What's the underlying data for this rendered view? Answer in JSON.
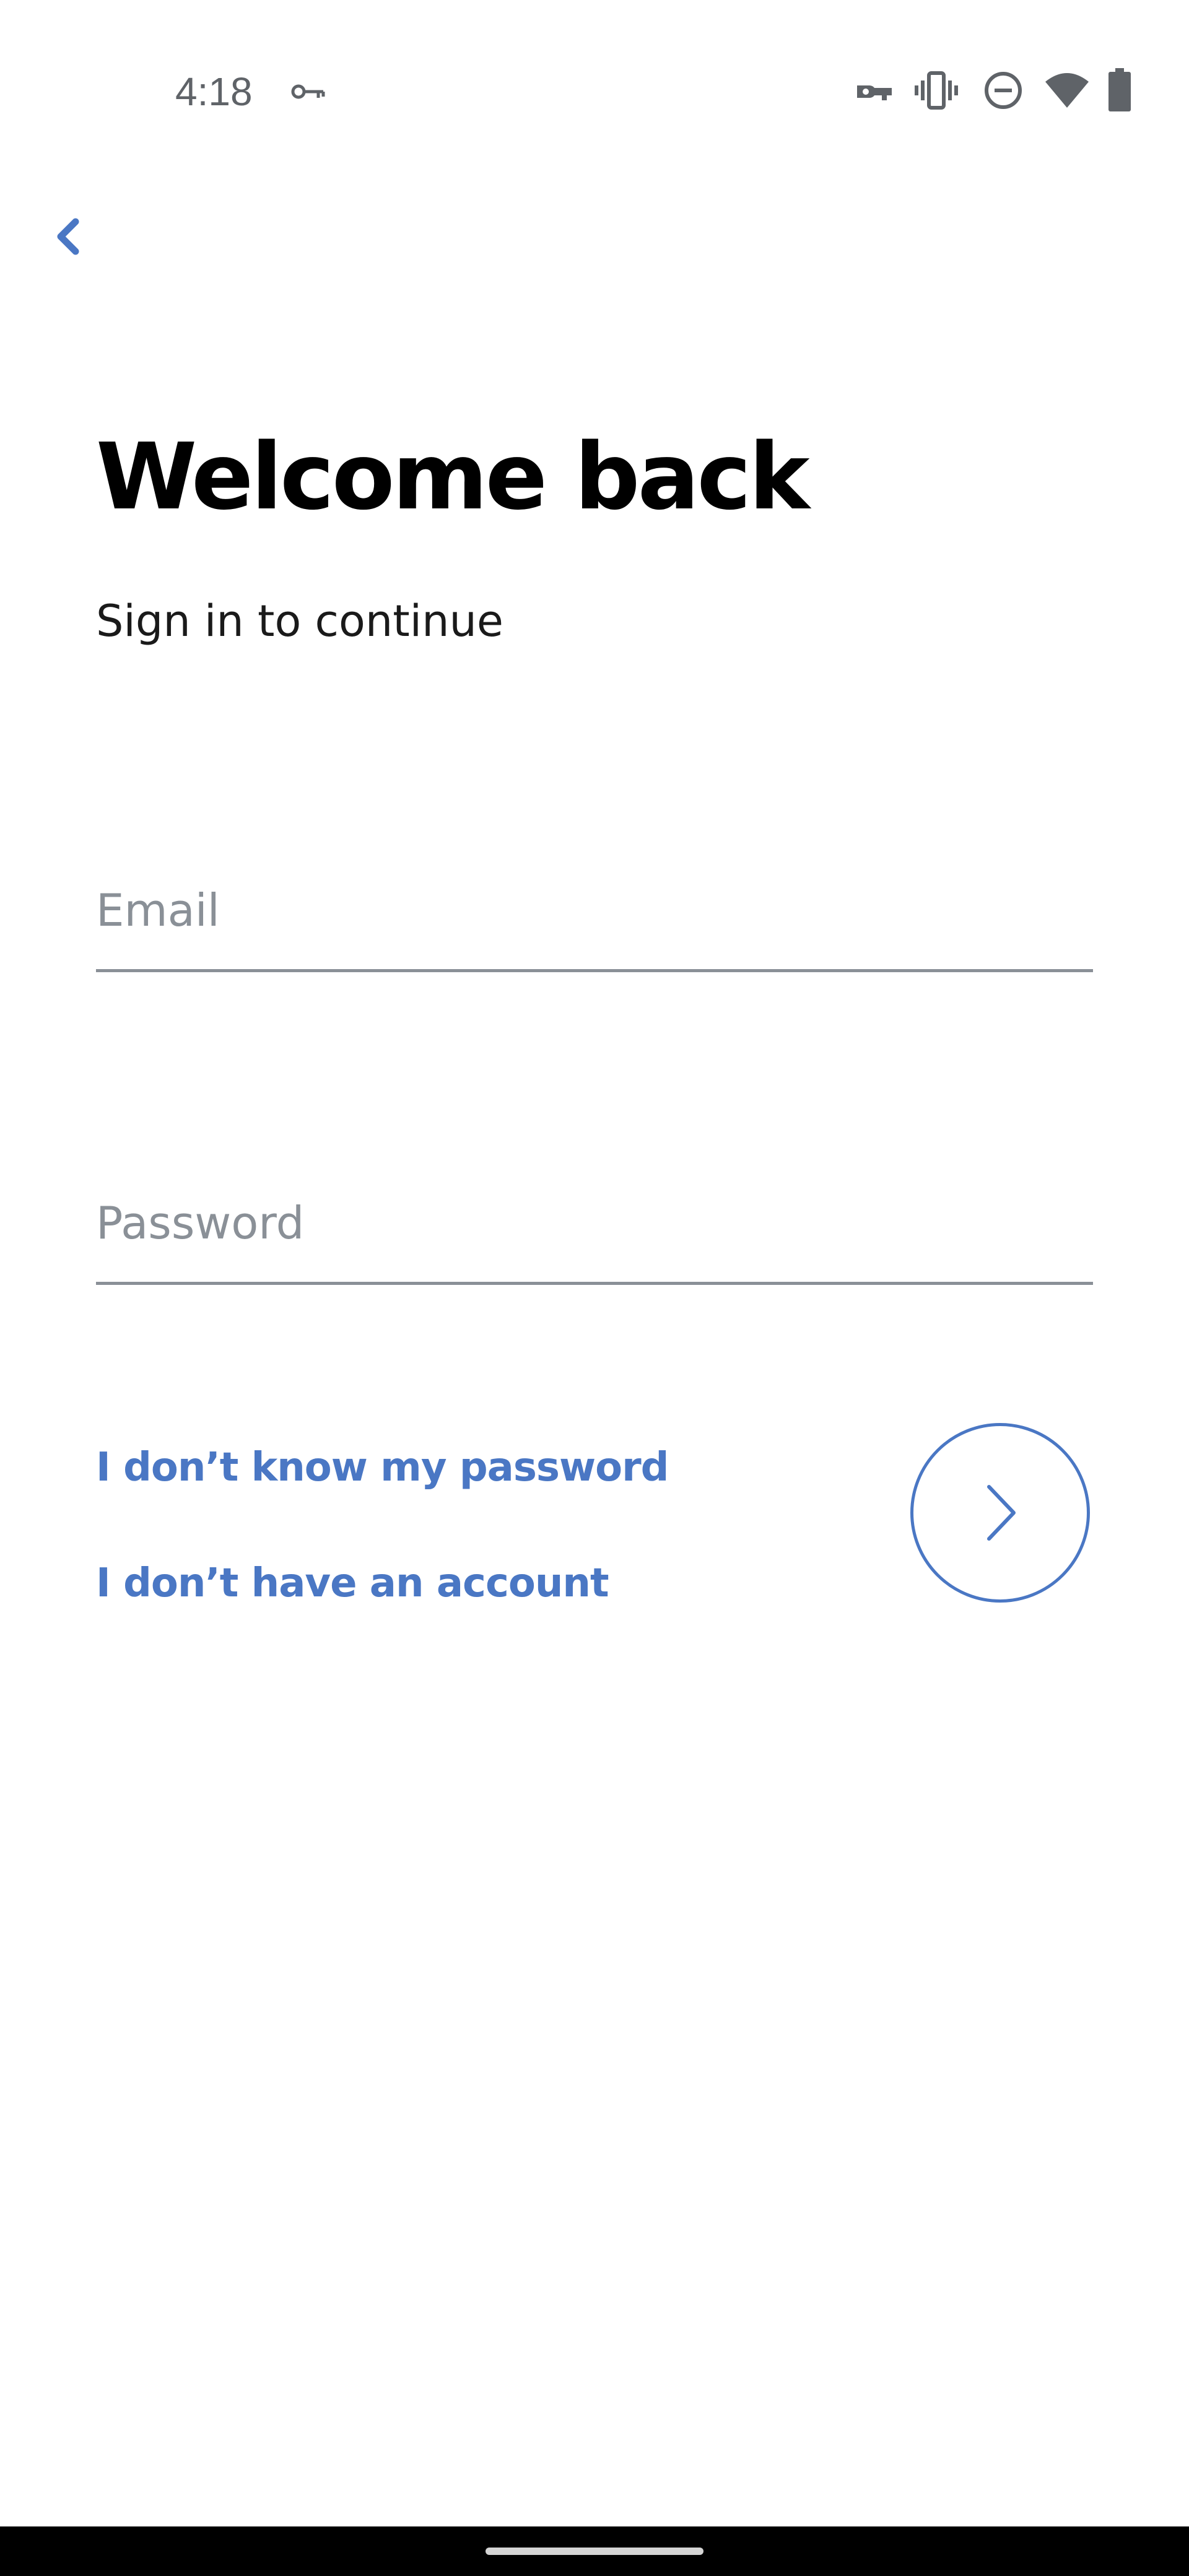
{
  "status_bar": {
    "time": "4:18",
    "icons": [
      "key-icon",
      "vpn-key-icon",
      "vibrate-icon",
      "do-not-disturb-icon",
      "wifi-icon",
      "battery-icon"
    ]
  },
  "nav": {
    "back_icon": "chevron-left-icon"
  },
  "header": {
    "title": "Welcome back",
    "subtitle": "Sign in to continue"
  },
  "form": {
    "email": {
      "placeholder": "Email",
      "value": ""
    },
    "password": {
      "placeholder": "Password",
      "value": ""
    },
    "forgot_password_link": "I don’t know my password",
    "no_account_link": "I don’t have an account",
    "submit_icon": "chevron-right-icon"
  },
  "colors": {
    "accent": "#4a77c4",
    "field_line": "#8a9097",
    "placeholder": "#8a9097",
    "status_icons": "#5f6368",
    "nav_bar": "#000000"
  }
}
